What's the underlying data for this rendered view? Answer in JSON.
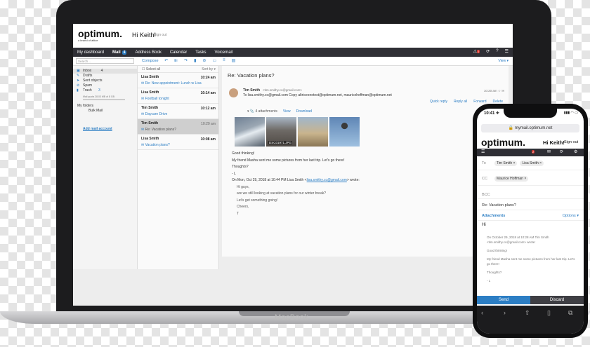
{
  "laptop": {
    "brand": "MacBook",
    "header": {
      "logo": "optimum.",
      "logo_sub": "a brand of altice",
      "greeting": "Hi Keith!",
      "signout": "Sign out"
    },
    "nav": {
      "items": [
        "My dashboard",
        "Mail",
        "Address Book",
        "Calendar",
        "Tasks",
        "Voicemail"
      ],
      "mail_badge": "4",
      "alert_badge": "2"
    },
    "toolbar": {
      "search_placeholder": "Search...",
      "compose": "Compose",
      "view": "View ▾"
    },
    "folders": {
      "items": [
        {
          "label": "Inbox",
          "count": "4"
        },
        {
          "label": "Drafts",
          "count": ""
        },
        {
          "label": "Sent objects",
          "count": ""
        },
        {
          "label": "Spam",
          "count": ""
        },
        {
          "label": "Trash",
          "count": "3"
        }
      ],
      "quota": "Mail quota   28.03 MB of 8 GB",
      "my_folders": "My folders",
      "bulk_mail": "Bulk Mail",
      "add_mail": "Add mail account"
    },
    "list": {
      "select_all": "Select all",
      "sort": "Sort by ▾",
      "messages": [
        {
          "from": "Lisa Smith",
          "time": "10:24 am",
          "subject": "Re: New appointment: Lunch w Lisa"
        },
        {
          "from": "Lisa Smith",
          "time": "10:14 am",
          "subject": "Football tonight"
        },
        {
          "from": "Tim Smith",
          "time": "10:12 am",
          "subject": "Daycare Drive"
        },
        {
          "from": "Tim Smith",
          "time": "10:20 am",
          "subject": "Re: Vacation plans?"
        },
        {
          "from": "Lisa Smith",
          "time": "10:08 am",
          "subject": "Vacation plans?"
        }
      ]
    },
    "reader": {
      "subject": "Re: Vacation plans?",
      "from": "Tim Smith",
      "from_addr": "<tim.smithy.cc@gmail.com>",
      "to": "To  lisa.smithy.cc@gmail.com  Copy  altriceonetest@optimum.net,   mauriceheffman@optimum.net",
      "date": "10:20 am  ☆ ✉",
      "actions": [
        "Quick reply",
        "Reply all",
        "Forward",
        "Delete"
      ],
      "attachments_label": "▾ 📎 4 attachments",
      "view": "View",
      "download": "Download",
      "thumb_label": "DSC01971.JPG",
      "body": [
        "Good thinking!",
        "My friend Masha sent me some pictures from her last trip. Let's go there!",
        "Thoughts?",
        "- L",
        "On Mon, Oct 29, 2018 at 10:44 PM Lisa Smith <",
        "lisa.smithy.cc@gmail.com",
        "> wrote:"
      ],
      "quoted": [
        "Hi guys,",
        "are we still looking at vacation plans for our winter break?",
        "Let's get something going!",
        "Cheers,",
        "T"
      ]
    }
  },
  "phone": {
    "time": "10:41 ✈",
    "status_right": "▮▮▮ ◠ ▭",
    "url": "🔒 mymail.optimum.net",
    "logo": "optimum.",
    "greeting": "Hi Keith!",
    "signout": "Sign out",
    "alert_badge": "2",
    "to_label": "To",
    "to_chips": [
      "Tim Smith ×",
      "Lisa Smith ×"
    ],
    "cc_label": "CC",
    "cc_chips": [
      "Maurice Hoffman ×"
    ],
    "bcc_label": "BCC",
    "subject": "Re: Vacation plans?",
    "attachments": "Attachments",
    "options": "Options ▾",
    "body_text": "Hi",
    "quote": [
      "On October 29, 2018 at 10:28 AM Tim Smith <tim.smithy.cc@gmail.com> wrote:",
      "Good thinking!",
      "My friend Masha sent me some pictures from her last trip. Let's go there!",
      "Thoughts?",
      "- L"
    ],
    "send": "Send",
    "discard": "Discard"
  }
}
